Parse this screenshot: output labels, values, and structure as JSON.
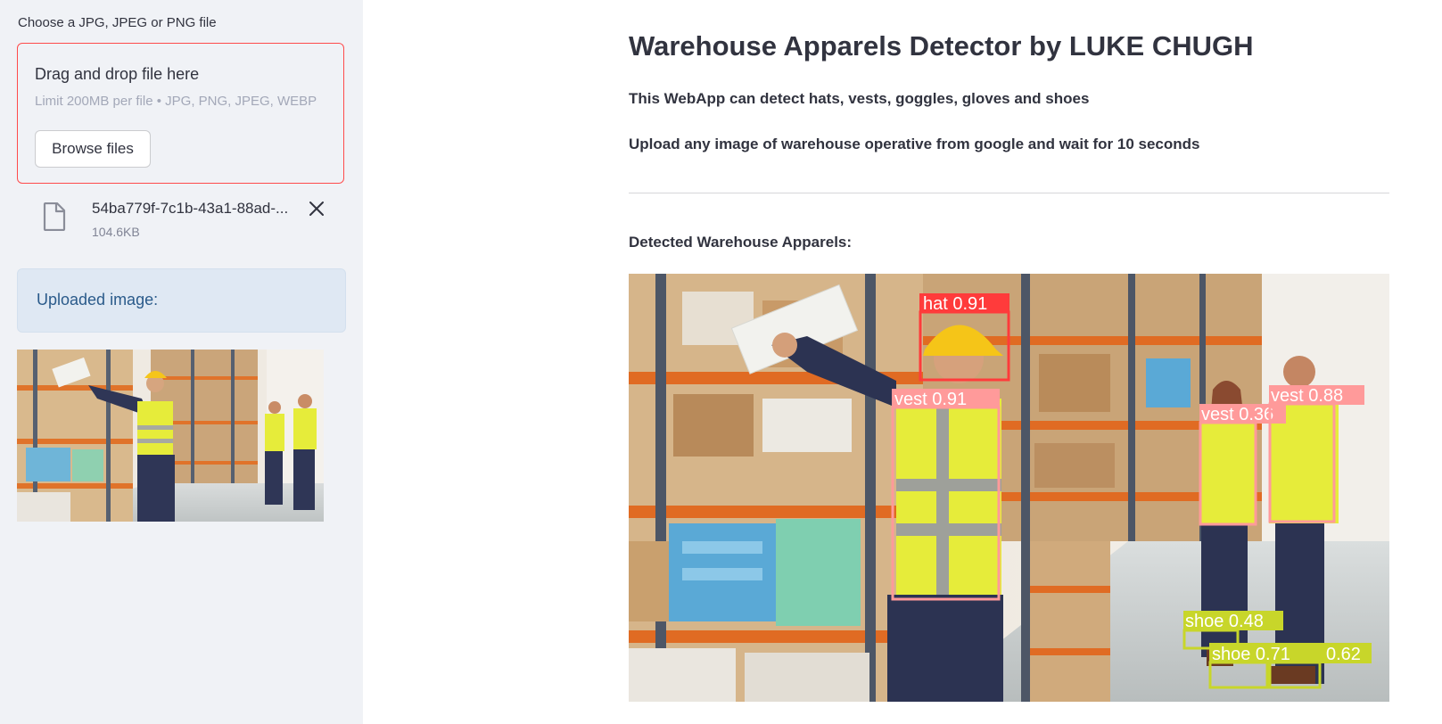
{
  "sidebar": {
    "uploader_label": "Choose a JPG, JPEG or PNG file",
    "dropzone_title": "Drag and drop file here",
    "dropzone_limit": "Limit 200MB per file • JPG, PNG, JPEG, WEBP",
    "browse_label": "Browse files",
    "file": {
      "name": "54ba779f-7c1b-43a1-88ad-...",
      "size": "104.6KB",
      "icon": "file-icon",
      "close_icon": "close-icon"
    },
    "info_text": "Uploaded image:"
  },
  "main": {
    "title": "Warehouse Apparels Detector by LUKE CHUGH",
    "description": "This WebApp can detect hats, vests, goggles, gloves and shoes",
    "instruction": "Upload any image of warehouse operative from google and wait for 10 seconds",
    "detected_label": "Detected Warehouse Apparels:",
    "detections": [
      {
        "label": "hat 0.91",
        "color": "#ff3b3b"
      },
      {
        "label": "vest 0.91",
        "color": "#ff9a9a"
      },
      {
        "label": "vest 0.36",
        "color": "#ff9a9a"
      },
      {
        "label": "vest 0.88",
        "color": "#ff9a9a"
      },
      {
        "label": "shoe 0.48",
        "color": "#c8d62a"
      },
      {
        "label": "shoe 0.71",
        "color": "#c8d62a"
      },
      {
        "label": "0.62",
        "color": "#c8d62a"
      }
    ]
  },
  "colors": {
    "accent": "#ff4b4b",
    "sidebar_bg": "#f0f2f6",
    "info_bg": "#dfe8f3",
    "text": "#31333f"
  }
}
